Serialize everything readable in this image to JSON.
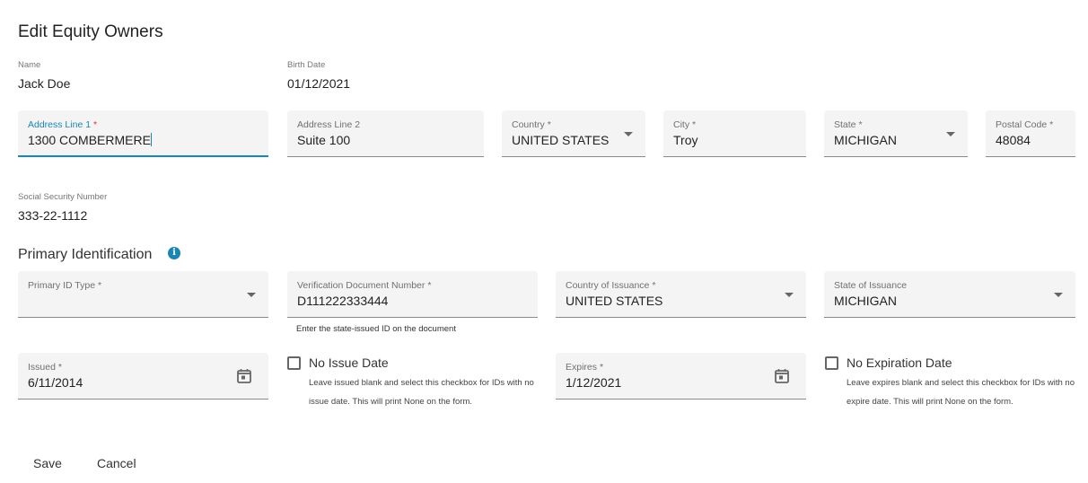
{
  "page": {
    "title": "Edit Equity Owners"
  },
  "owner": {
    "name_label": "Name",
    "name_value": "Jack Doe",
    "birth_label": "Birth Date",
    "birth_value": "01/12/2021",
    "ssn_label": "Social Security Number",
    "ssn_value": "333-22-1112"
  },
  "address": {
    "line1": {
      "label": "Address Line 1",
      "required": "*",
      "value": "1300 COMBERMERE"
    },
    "line2": {
      "label": "Address Line 2",
      "value": "Suite 100"
    },
    "country": {
      "label": "Country",
      "required": "*",
      "value": "UNITED STATES"
    },
    "city": {
      "label": "City",
      "required": "*",
      "value": "Troy"
    },
    "state": {
      "label": "State",
      "required": "*",
      "value": "MICHIGAN"
    },
    "postal": {
      "label": "Postal Code",
      "required": "*",
      "value": "48084"
    }
  },
  "identification": {
    "section_title": "Primary Identification",
    "info_icon": "i",
    "id_type": {
      "label": "Primary ID Type",
      "required": "*",
      "value": ""
    },
    "doc_number": {
      "label": "Verification Document Number",
      "required": "*",
      "value": "D111222333444",
      "hint": "Enter the state-issued ID on the document"
    },
    "country_issuance": {
      "label": "Country of Issuance",
      "required": "*",
      "value": "UNITED STATES"
    },
    "state_issuance": {
      "label": "State of Issuance",
      "value": "MICHIGAN"
    },
    "issued": {
      "label": "Issued",
      "required": "*",
      "value": "6/11/2014"
    },
    "no_issue": {
      "label": "No Issue Date",
      "checked": false,
      "help": "Leave issued blank and select this checkbox for IDs with no issue date. This will print None on the form."
    },
    "expires": {
      "label": "Expires",
      "required": "*",
      "value": "1/12/2021"
    },
    "no_expire": {
      "label": "No Expiration Date",
      "checked": false,
      "help": "Leave expires blank and select this checkbox for IDs with no expire date. This will print None on the form."
    }
  },
  "actions": {
    "save": "Save",
    "cancel": "Cancel"
  },
  "colors": {
    "accent": "#1a86b3",
    "required_focused": "#dd3333",
    "field_bg": "#f4f4f4"
  }
}
